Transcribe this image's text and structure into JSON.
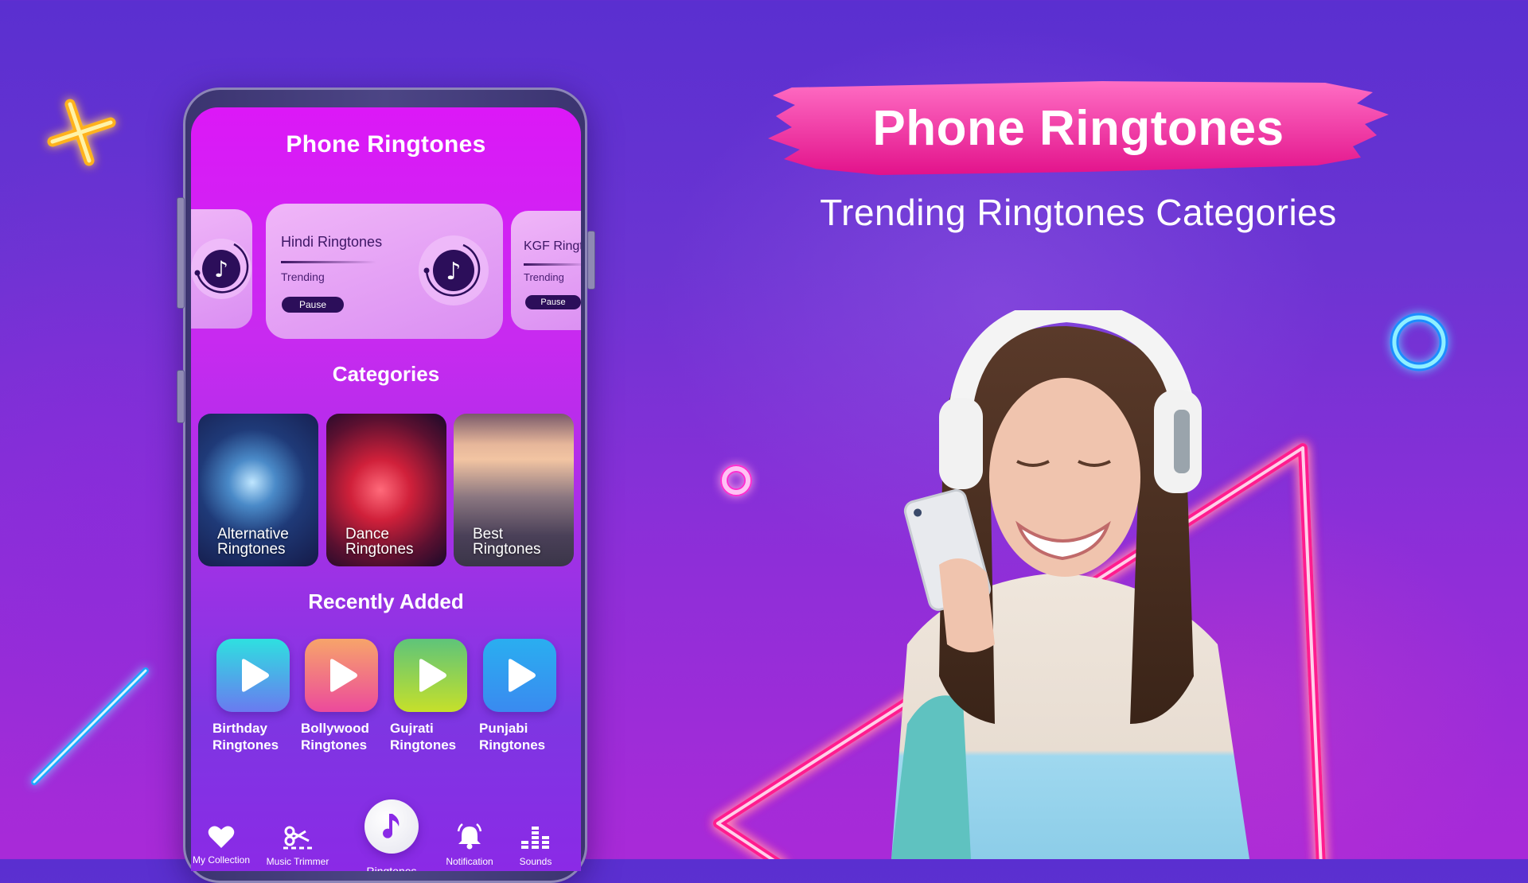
{
  "banner": {
    "title": "Phone Ringtones",
    "subtitle": "Trending Ringtones Categories",
    "brush_color_top": "#ff6ec4",
    "brush_color_bottom": "#e2128b"
  },
  "app": {
    "title": "Phone Ringtones",
    "carousel": [
      {
        "title": "",
        "status": "",
        "button": ""
      },
      {
        "title": "Hindi Ringtones",
        "status": "Trending",
        "button": "Pause"
      },
      {
        "title": "KGF Ringtones",
        "status": "Trending",
        "button": "Pause"
      }
    ],
    "categories_title": "Categories",
    "categories": [
      {
        "line1": "Alternative",
        "line2": "Ringtones"
      },
      {
        "line1": "Dance",
        "line2": "Ringtones"
      },
      {
        "line1": "Best",
        "line2": "Ringtones"
      }
    ],
    "recent_title": "Recently Added",
    "recent": [
      {
        "line1": "Birthday",
        "line2": "Ringtones",
        "icon": "play-icon",
        "color_top": "#2ee0e0",
        "color_bottom": "#6a7af0"
      },
      {
        "line1": "Bollywood",
        "line2": "Ringtones",
        "icon": "play-icon",
        "color_top": "#f7a46a",
        "color_bottom": "#ec4a9c"
      },
      {
        "line1": "Gujrati",
        "line2": "Ringtones",
        "icon": "play-icon",
        "color_top": "#5ec47a",
        "color_bottom": "#c6e02a"
      },
      {
        "line1": "Punjabi",
        "line2": "Ringtones",
        "icon": "play-icon",
        "color_top": "#2aaef0",
        "color_bottom": "#3a8af0"
      }
    ],
    "nav": [
      {
        "label": "My Collection",
        "icon": "heart-icon"
      },
      {
        "label": "Music Trimmer",
        "icon": "scissors-icon"
      },
      {
        "label": "Ringtones",
        "icon": "music-note-icon",
        "active": true
      },
      {
        "label": "Notification",
        "icon": "bell-icon"
      },
      {
        "label": "Sounds",
        "icon": "equalizer-icon"
      }
    ]
  },
  "colors": {
    "background": "#6236d2",
    "accent_pink": "#ff2fa8",
    "accent_cyan": "#3ad8ff",
    "accent_yellow": "#ffd23a",
    "card_text": "#3d1665"
  }
}
